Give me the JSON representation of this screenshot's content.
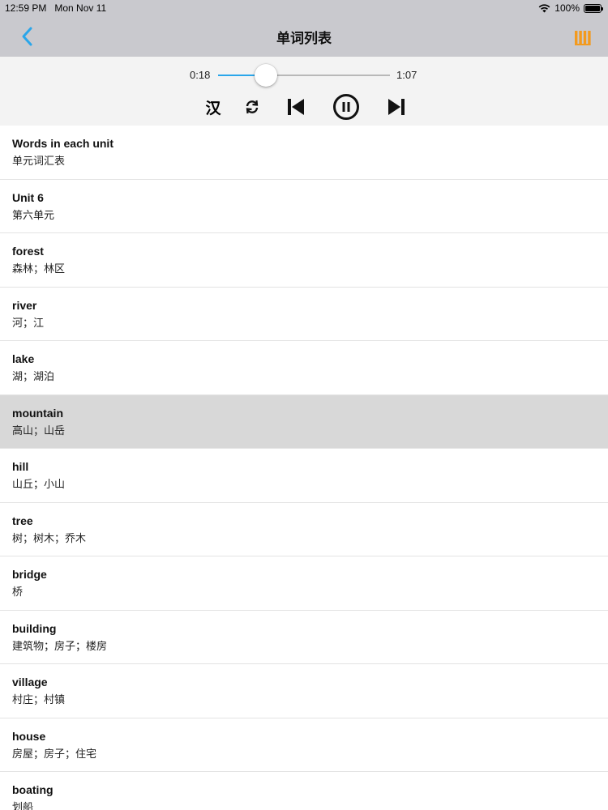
{
  "status_bar": {
    "time": "12:59 PM",
    "date": "Mon Nov 11",
    "battery": "100%"
  },
  "nav": {
    "title": "单词列表",
    "back_icon": "chevron-left-icon",
    "menu_icon": "library-bars-icon",
    "accent_color": "#2aa6ea",
    "menu_color": "#f39a1e"
  },
  "player": {
    "current_time": "0:18",
    "total_time": "1:07",
    "progress": 0.28,
    "han_label": "汉",
    "icons": [
      "loop-icon",
      "previous-track-icon",
      "pause-icon",
      "next-track-icon"
    ]
  },
  "words": [
    {
      "en": "Words in each unit",
      "cn": "单元词汇表",
      "selected": false
    },
    {
      "en": "Unit 6",
      "cn": "第六单元",
      "selected": false
    },
    {
      "en": "forest",
      "cn": "森林；林区",
      "selected": false
    },
    {
      "en": "river",
      "cn": "河；江",
      "selected": false
    },
    {
      "en": "lake",
      "cn": "湖；湖泊",
      "selected": false
    },
    {
      "en": "mountain",
      "cn": "高山；山岳",
      "selected": true
    },
    {
      "en": "hill",
      "cn": "山丘；小山",
      "selected": false
    },
    {
      "en": "tree",
      "cn": "树；树木；乔木",
      "selected": false
    },
    {
      "en": "bridge",
      "cn": "桥",
      "selected": false
    },
    {
      "en": "building",
      "cn": "建筑物；房子；楼房",
      "selected": false
    },
    {
      "en": "village",
      "cn": "村庄；村镇",
      "selected": false
    },
    {
      "en": "house",
      "cn": "房屋；房子；住宅",
      "selected": false
    },
    {
      "en": "boating",
      "cn": "划船",
      "selected": false
    }
  ]
}
